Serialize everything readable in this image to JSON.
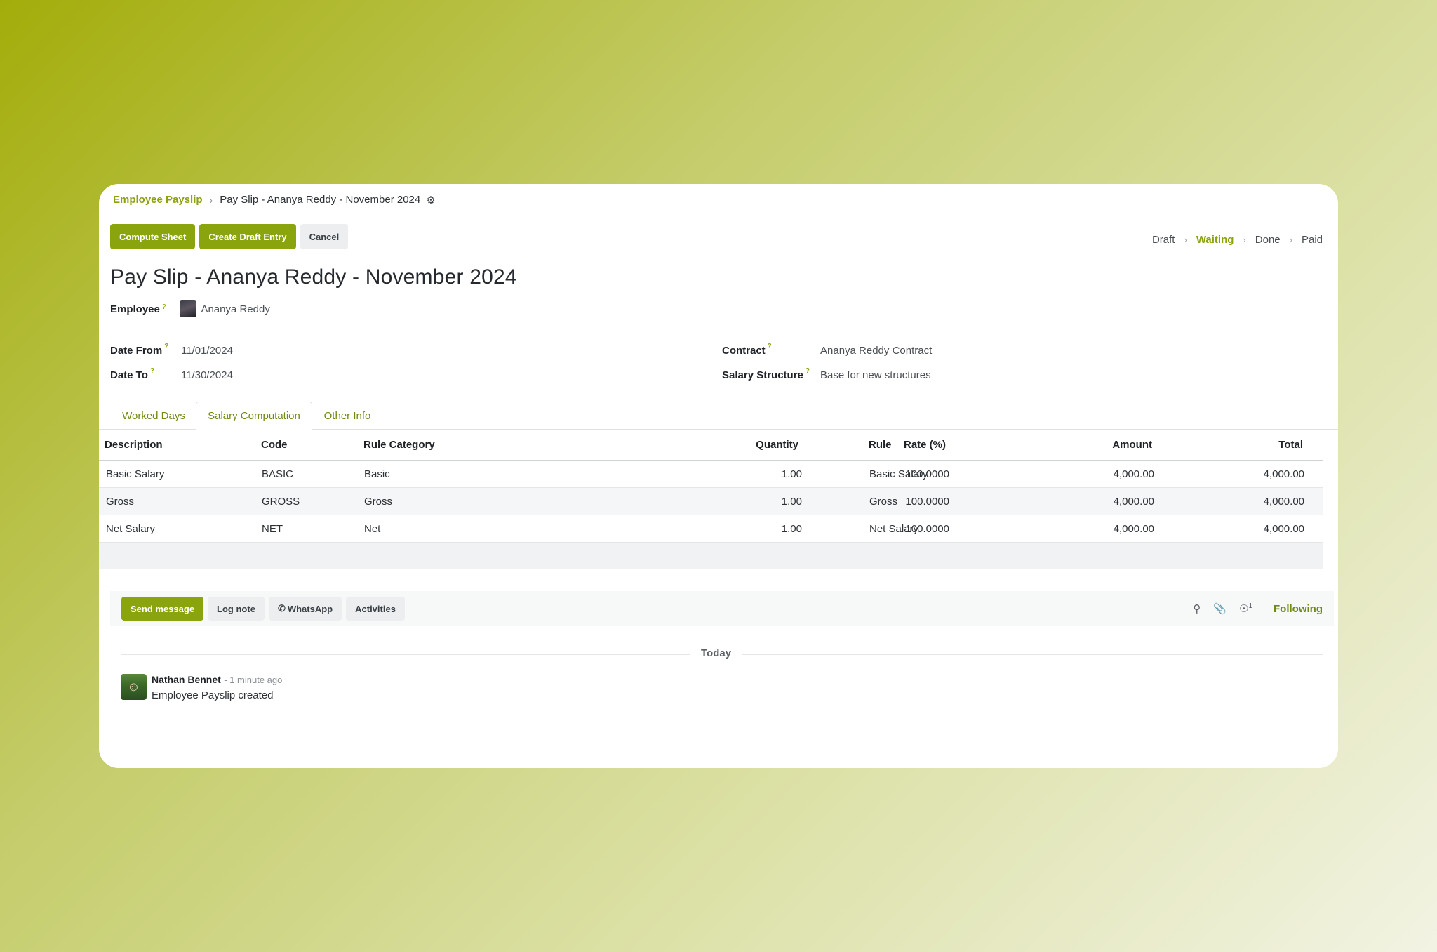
{
  "breadcrumb": {
    "parent": "Employee Payslip",
    "current": "Pay Slip - Ananya Reddy - November 2024"
  },
  "actions": {
    "compute": "Compute Sheet",
    "draft": "Create Draft Entry",
    "cancel": "Cancel"
  },
  "status": {
    "stages": [
      "Draft",
      "Waiting",
      "Done",
      "Paid"
    ],
    "active": "Waiting"
  },
  "title": "Pay Slip - Ananya Reddy - November 2024",
  "employee": {
    "label": "Employee",
    "value": "Ananya Reddy"
  },
  "fields": {
    "date_from": {
      "label": "Date From",
      "value": "11/01/2024"
    },
    "date_to": {
      "label": "Date To",
      "value": "11/30/2024"
    },
    "contract": {
      "label": "Contract",
      "value": "Ananya Reddy Contract"
    },
    "structure": {
      "label": "Salary Structure",
      "value": "Base for new structures"
    }
  },
  "help_mark": "?",
  "tabs": [
    "Worked Days",
    "Salary Computation",
    "Other Info"
  ],
  "table": {
    "headers": [
      "Description",
      "Code",
      "Rule Category",
      "Quantity",
      "Rate (%)",
      "Rule",
      "Amount",
      "Total"
    ],
    "rows": [
      [
        "Basic Salary",
        "BASIC",
        "Basic",
        "1.00",
        "100.0000",
        "Basic Salary",
        "4,000.00",
        "4,000.00"
      ],
      [
        "Gross",
        "GROSS",
        "Gross",
        "1.00",
        "100.0000",
        "Gross",
        "4,000.00",
        "4,000.00"
      ],
      [
        "Net Salary",
        "NET",
        "Net",
        "1.00",
        "100.0000",
        "Net Salary",
        "4,000.00",
        "4,000.00"
      ]
    ]
  },
  "chatter": {
    "send": "Send message",
    "log": "Log note",
    "whatsapp": "WhatsApp",
    "activities": "Activities",
    "followers_count": "1",
    "following": "Following",
    "today": "Today",
    "message": {
      "author": "Nathan Bennet",
      "time": "- 1 minute ago",
      "body": "Employee Payslip created"
    }
  },
  "colors": {
    "accent": "#8aa40e",
    "link": "#6f8a10"
  }
}
